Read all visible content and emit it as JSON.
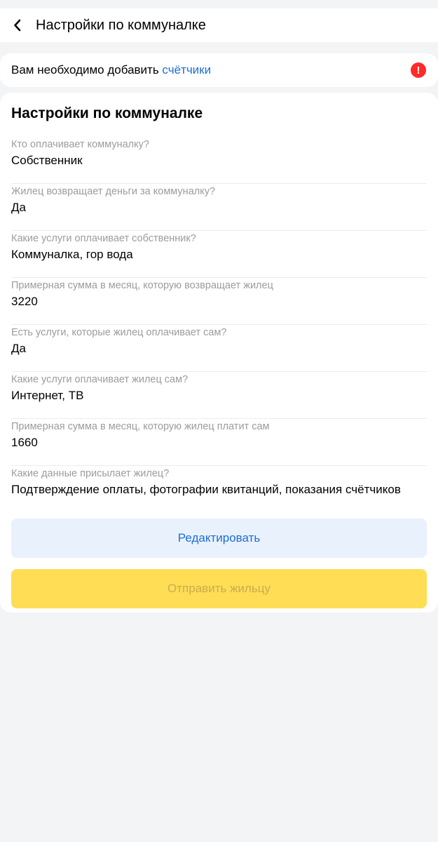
{
  "header": {
    "title": "Настройки по коммуналке"
  },
  "alert": {
    "text": "Вам необходимо добавить ",
    "link": "счётчики",
    "icon": "!"
  },
  "card": {
    "title": "Настройки по коммуналке",
    "fields": [
      {
        "label": "Кто оплачивает коммуналку?",
        "value": "Собственник"
      },
      {
        "label": "Жилец возвращает деньги за коммуналку?",
        "value": "Да"
      },
      {
        "label": "Какие услуги оплачивает собственник?",
        "value": "Коммуналка, гор вода"
      },
      {
        "label": "Примерная сумма в месяц, которую возвращает жилец",
        "value": "3220"
      },
      {
        "label": "Есть услуги, которые жилец оплачивает сам?",
        "value": "Да"
      },
      {
        "label": "Какие услуги оплачивает жилец сам?",
        "value": "Интернет, ТВ"
      },
      {
        "label": "Примерная сумма в месяц, которую жилец платит сам",
        "value": "1660"
      },
      {
        "label": "Какие данные присылает жилец?",
        "value": "Подтверждение оплаты, фотографии квитанций, показания счётчиков"
      }
    ],
    "edit_label": "Редактировать",
    "send_label": "Отправить жильцу"
  },
  "colors": {
    "accent_blue": "#1a6fd6",
    "alert_red": "#ff2a2a",
    "send_yellow": "#ffdd55"
  }
}
